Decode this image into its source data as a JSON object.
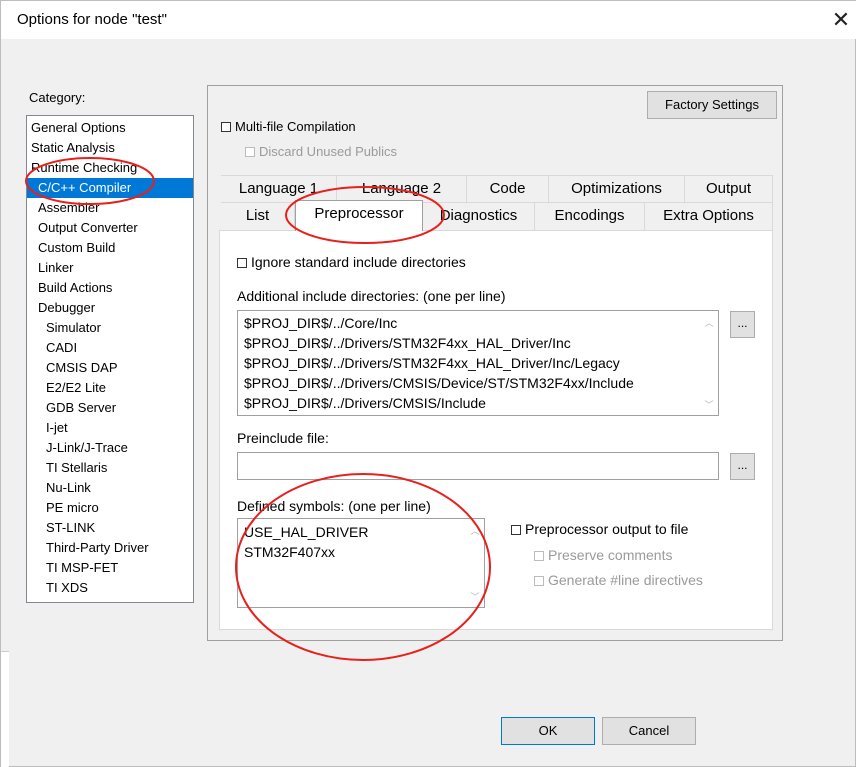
{
  "window": {
    "title": "Options for node \"test\""
  },
  "category": {
    "label": "Category:",
    "items": [
      {
        "label": "General Options",
        "indent": 0,
        "selected": false
      },
      {
        "label": "Static Analysis",
        "indent": 0,
        "selected": false
      },
      {
        "label": "Runtime Checking",
        "indent": 0,
        "selected": false
      },
      {
        "label": "C/C++ Compiler",
        "indent": 1,
        "selected": true
      },
      {
        "label": "Assembler",
        "indent": 1,
        "selected": false
      },
      {
        "label": "Output Converter",
        "indent": 1,
        "selected": false
      },
      {
        "label": "Custom Build",
        "indent": 1,
        "selected": false
      },
      {
        "label": "Linker",
        "indent": 1,
        "selected": false
      },
      {
        "label": "Build Actions",
        "indent": 1,
        "selected": false
      },
      {
        "label": "Debugger",
        "indent": 1,
        "selected": false
      },
      {
        "label": "Simulator",
        "indent": 2,
        "selected": false
      },
      {
        "label": "CADI",
        "indent": 2,
        "selected": false
      },
      {
        "label": "CMSIS DAP",
        "indent": 2,
        "selected": false
      },
      {
        "label": "E2/E2 Lite",
        "indent": 2,
        "selected": false
      },
      {
        "label": "GDB Server",
        "indent": 2,
        "selected": false
      },
      {
        "label": "I-jet",
        "indent": 2,
        "selected": false
      },
      {
        "label": "J-Link/J-Trace",
        "indent": 2,
        "selected": false
      },
      {
        "label": "TI Stellaris",
        "indent": 2,
        "selected": false
      },
      {
        "label": "Nu-Link",
        "indent": 2,
        "selected": false
      },
      {
        "label": "PE micro",
        "indent": 2,
        "selected": false
      },
      {
        "label": "ST-LINK",
        "indent": 2,
        "selected": false
      },
      {
        "label": "Third-Party Driver",
        "indent": 2,
        "selected": false
      },
      {
        "label": "TI MSP-FET",
        "indent": 2,
        "selected": false
      },
      {
        "label": "TI XDS",
        "indent": 2,
        "selected": false
      }
    ]
  },
  "factory_settings": "Factory Settings",
  "multifile": {
    "label": "Multi-file Compilation",
    "checked": false
  },
  "discard_unused": {
    "label": "Discard Unused Publics",
    "checked": false,
    "enabled": false
  },
  "tabs_row1": [
    "Language 1",
    "Language 2",
    "Code",
    "Optimizations",
    "Output"
  ],
  "tabs_row2": [
    "List",
    "Preprocessor",
    "Diagnostics",
    "Encodings",
    "Extra Options"
  ],
  "active_tab": "Preprocessor",
  "preprocessor": {
    "ignore_std_label": "Ignore standard include directories",
    "include_dirs_label": "Additional include directories: (one per line)",
    "include_dirs": [
      "$PROJ_DIR$/../Core/Inc",
      "$PROJ_DIR$/../Drivers/STM32F4xx_HAL_Driver/Inc",
      "$PROJ_DIR$/../Drivers/STM32F4xx_HAL_Driver/Inc/Legacy",
      "$PROJ_DIR$/../Drivers/CMSIS/Device/ST/STM32F4xx/Include",
      "$PROJ_DIR$/../Drivers/CMSIS/Include"
    ],
    "browse_label": "...",
    "preinclude_label": "Preinclude file:",
    "preinclude_value": "",
    "defined_symbols_label": "Defined symbols: (one per line)",
    "defined_symbols": [
      "USE_HAL_DRIVER",
      "STM32F407xx"
    ],
    "output_to_file_label": "Preprocessor output to file",
    "preserve_comments_label": "Preserve comments",
    "generate_line_label": "Generate #line directives"
  },
  "buttons": {
    "ok": "OK",
    "cancel": "Cancel"
  },
  "colors": {
    "selection": "#0078d7",
    "annotation": "#e8201c",
    "dialog_bg": "#f0f0f0"
  }
}
